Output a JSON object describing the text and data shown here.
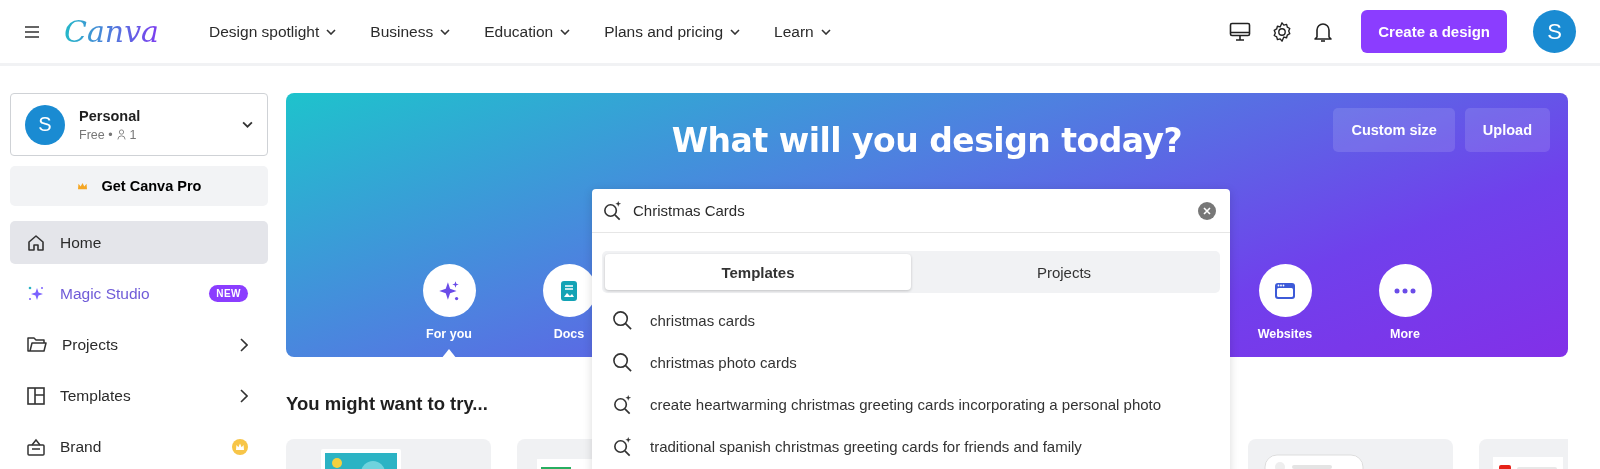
{
  "header": {
    "logo": "Canva",
    "nav": [
      {
        "label": "Design spotlight"
      },
      {
        "label": "Business"
      },
      {
        "label": "Education"
      },
      {
        "label": "Plans and pricing"
      },
      {
        "label": "Learn"
      }
    ],
    "create_button": "Create a design",
    "avatar": "S"
  },
  "sidebar": {
    "account": {
      "avatar": "S",
      "name": "Personal",
      "plan": "Free •",
      "members": "1"
    },
    "pro_button": "Get Canva Pro",
    "items": [
      {
        "label": "Home",
        "kind": "nav",
        "selected": true
      },
      {
        "label": "Magic Studio",
        "kind": "feature",
        "badge": "NEW",
        "selected": false
      },
      {
        "label": "Projects",
        "kind": "folder",
        "selected": false
      },
      {
        "label": "Templates",
        "kind": "folder",
        "selected": false
      },
      {
        "label": "Brand",
        "kind": "premium",
        "selected": false
      }
    ]
  },
  "banner": {
    "title": "What will you design today?",
    "buttons": [
      "Custom size",
      "Upload"
    ],
    "categories": [
      {
        "label": "For you",
        "selected": true
      },
      {
        "label": "Docs",
        "selected": false
      },
      {
        "label": "Websites",
        "selected": false
      },
      {
        "label": "More",
        "selected": false
      }
    ]
  },
  "search": {
    "value": "Christmas Cards",
    "tabs": [
      {
        "label": "Templates",
        "selected": true
      },
      {
        "label": "Projects",
        "selected": false
      }
    ],
    "suggestions": [
      {
        "text": "christmas cards",
        "kind": "search"
      },
      {
        "text": "christmas photo cards",
        "kind": "search"
      },
      {
        "text": "create heartwarming christmas greeting cards incorporating a personal photo",
        "kind": "magic"
      },
      {
        "text": "traditional spanish christmas greeting cards for friends and family",
        "kind": "magic"
      }
    ]
  },
  "section_title": "You might want to try..."
}
